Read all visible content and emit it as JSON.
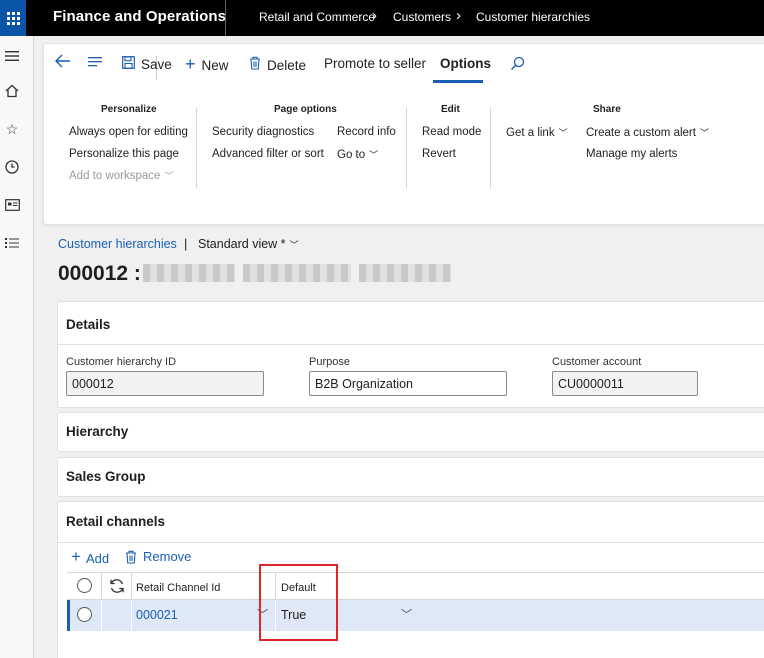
{
  "topbar": {
    "app_title": "Finance and Operations",
    "breadcrumbs": [
      "Retail and Commerce",
      "Customers",
      "Customer hierarchies"
    ]
  },
  "leftnav": {
    "icons": [
      "menu-icon",
      "home-icon",
      "star-icon",
      "clock-icon",
      "workspace-icon",
      "list-icon"
    ]
  },
  "toolbar": {
    "save": "Save",
    "new": "New",
    "delete": "Delete",
    "promote": "Promote to seller",
    "options": "Options"
  },
  "groups": {
    "personalize": {
      "title": "Personalize",
      "items": [
        "Always open for editing",
        "Personalize this page",
        "Add to workspace"
      ]
    },
    "page_options": {
      "title": "Page options",
      "items": [
        "Security diagnostics",
        "Advanced filter or sort",
        "Record info",
        "Go to"
      ]
    },
    "edit": {
      "title": "Edit",
      "items": [
        "Read mode",
        "Revert"
      ]
    },
    "share": {
      "title": "Share",
      "items": [
        "Get a link",
        "Create a custom alert",
        "Manage my alerts"
      ]
    }
  },
  "header": {
    "breadcrumb_link": "Customer hierarchies",
    "separator": "|",
    "view": "Standard view *",
    "title": "000012 :"
  },
  "details": {
    "title": "Details",
    "fields": [
      {
        "label": "Customer hierarchy ID",
        "value": "000012"
      },
      {
        "label": "Purpose",
        "value": "B2B Organization"
      },
      {
        "label": "Customer account",
        "value": "CU0000011"
      }
    ]
  },
  "sections": {
    "hierarchy": "Hierarchy",
    "sales_group": "Sales Group",
    "retail_channels": "Retail channels"
  },
  "grid": {
    "add": "Add",
    "remove": "Remove",
    "columns": [
      "Retail Channel Id",
      "Default"
    ],
    "rows": [
      {
        "channel_id": "000021",
        "default": "True"
      }
    ]
  },
  "colors": {
    "accent": "#1a5fb4",
    "topbar": "#000000",
    "waffle": "#0a55a8",
    "highlight_box": "#e0262a",
    "selected_row": "#dfe8f7"
  }
}
